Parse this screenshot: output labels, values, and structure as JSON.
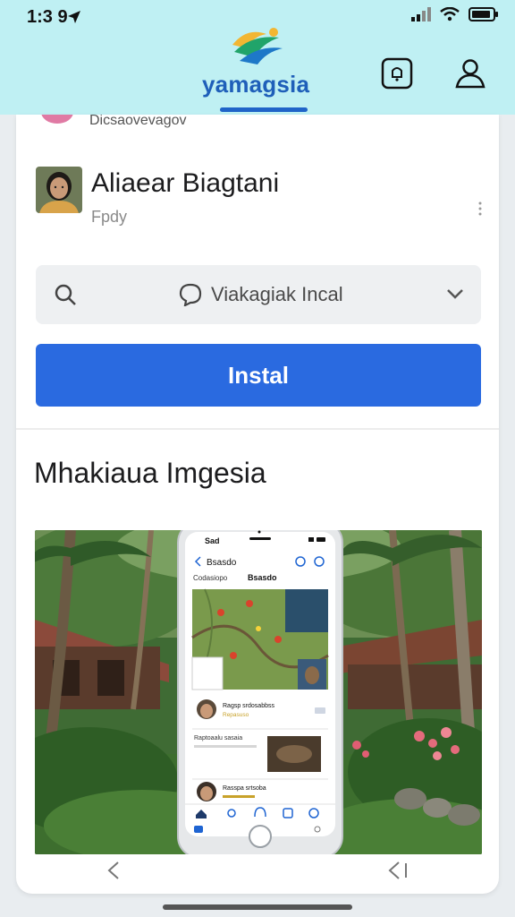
{
  "status_bar": {
    "time": "1:3 9"
  },
  "header": {
    "app_name": "yamagsia"
  },
  "feed": {
    "previous_item_caption": "Dicsaovevagov"
  },
  "profile": {
    "name": "Aliaear Biagtani",
    "subtitle": "Fpdy"
  },
  "search": {
    "text": "Viakagiak Incal"
  },
  "install": {
    "label": "Instal"
  },
  "section": {
    "title": "Mhakiaua Imgesia"
  },
  "mockup": {
    "status_time": "Sad",
    "back_label": "Bsasdo",
    "tab1": "Codasiopo",
    "tab2": "Bsasdo",
    "row1_title": "Ragsp srdosabbss",
    "row1_sub": "Repasuso",
    "row2_title": "Raptoaalu sasaia",
    "row3_title": "Rasspa srtsoba"
  }
}
